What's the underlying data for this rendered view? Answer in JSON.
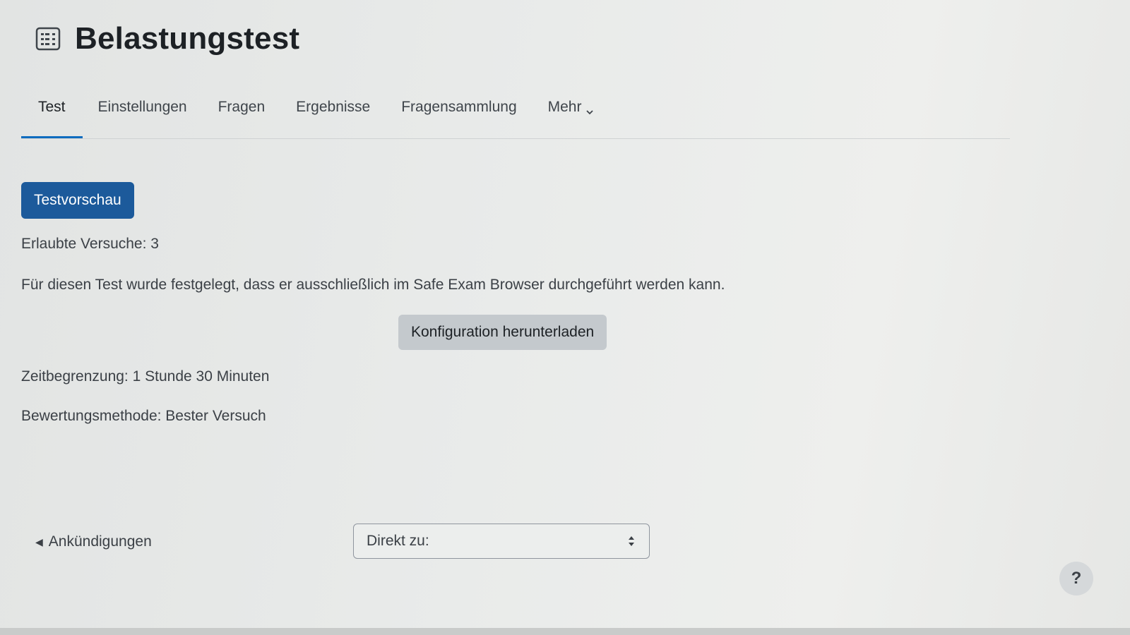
{
  "header": {
    "title": "Belastungstest",
    "icon": "quiz-icon"
  },
  "tabs": [
    {
      "label": "Test",
      "active": true
    },
    {
      "label": "Einstellungen",
      "active": false
    },
    {
      "label": "Fragen",
      "active": false
    },
    {
      "label": "Ergebnisse",
      "active": false
    },
    {
      "label": "Fragensammlung",
      "active": false
    },
    {
      "label": "Mehr",
      "active": false
    }
  ],
  "main": {
    "preview_button": "Testvorschau",
    "attempts": "Erlaubte Versuche: 3",
    "seb_notice": "Für diesen Test wurde festgelegt, dass er ausschließlich im Safe Exam Browser durchgeführt werden kann.",
    "download_config_button": "Konfiguration herunterladen",
    "time_limit": "Zeitbegrenzung: 1 Stunde 30 Minuten",
    "grading_method": "Bewertungsmethode: Bester Versuch"
  },
  "footer": {
    "prev_link": "Ankündigungen",
    "jump_select": "Direkt zu:",
    "help": "?"
  },
  "colors": {
    "primary": "#1c5a9b",
    "active_tab_underline": "#0f6cbf",
    "secondary_button": "#c4c9cd"
  }
}
